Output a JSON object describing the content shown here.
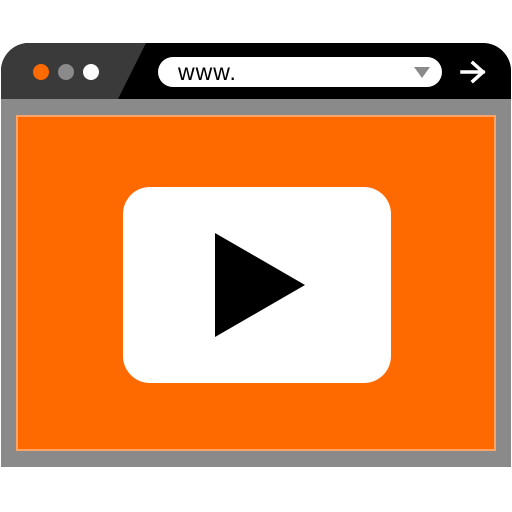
{
  "window": {
    "controls": [
      {
        "name": "close",
        "color": "#ff6a00"
      },
      {
        "name": "minimize",
        "color": "#8a8a8a"
      },
      {
        "name": "maximize",
        "color": "#ffffff"
      }
    ]
  },
  "address_bar": {
    "text": "www.",
    "dropdown_icon": "triangle-down-icon"
  },
  "navigation": {
    "forward_icon": "arrow-right-icon"
  },
  "content": {
    "background_color": "#ff6a00",
    "play_button_icon": "play-icon"
  },
  "colors": {
    "frame": "#8a8a8a",
    "titlebar": "#000000",
    "titlebar_panel": "#3a3a3a",
    "accent": "#ff6a00",
    "card": "#ffffff"
  }
}
